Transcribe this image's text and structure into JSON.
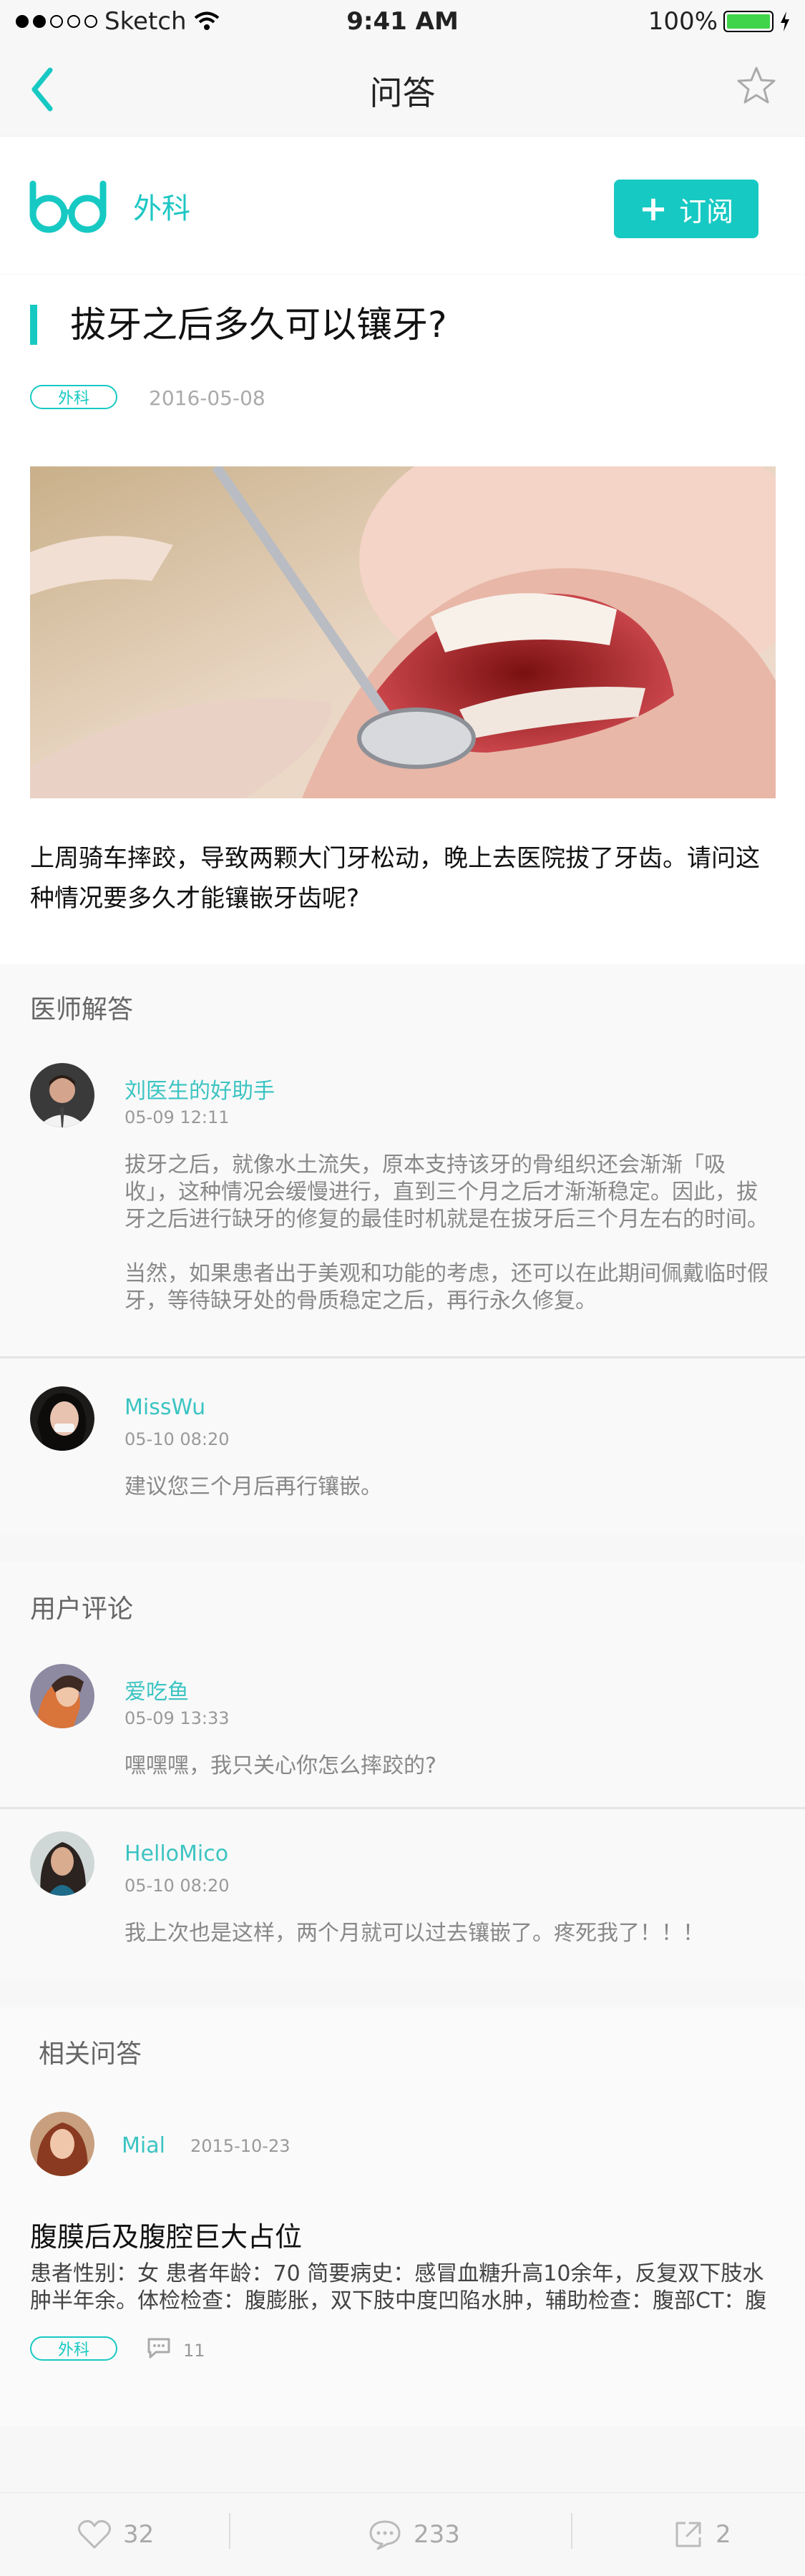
{
  "status_bar": {
    "carrier": "Sketch",
    "time": "9:41 AM",
    "battery": "100%"
  },
  "nav": {
    "title": "问答"
  },
  "category": {
    "name": "外科",
    "subscribe_label": "订阅"
  },
  "article": {
    "title": "拔牙之后多久可以镶牙?",
    "tag": "外科",
    "date": "2016-05-08",
    "body": "上周骑车摔跤，导致两颗大门牙松动，晚上去医院拔了牙齿。请问这种情况要多久才能镶嵌牙齿呢?"
  },
  "doctor_answers": {
    "title": "医师解答",
    "items": [
      {
        "name": "刘医生的好助手",
        "time": "05-09 12:11",
        "paragraphs": [
          "拔牙之后，就像水土流失，原本支持该牙的骨组织还会渐渐「吸收」，这种情况会缓慢进行，直到三个月之后才渐渐稳定。因此，拔牙之后进行缺牙的修复的最佳时机就是在拔牙后三个月左右的时间。",
          "当然，如果患者出于美观和功能的考虑，还可以在此期间佩戴临时假牙，等待缺牙处的骨质稳定之后，再行永久修复。"
        ]
      },
      {
        "name": "MissWu",
        "time": "05-10 08:20",
        "paragraphs": [
          "建议您三个月后再行镶嵌。"
        ]
      }
    ]
  },
  "user_comments": {
    "title": "用户评论",
    "items": [
      {
        "name": "爱吃鱼",
        "time": "05-09 13:33",
        "text": "嘿嘿嘿，我只关心你怎么摔跤的?"
      },
      {
        "name": "HelloMico",
        "time": "05-10 08:20",
        "text": "我上次也是这样，两个月就可以过去镶嵌了。疼死我了！！！"
      }
    ]
  },
  "related": {
    "title": "相关问答",
    "user": "Mial",
    "date": "2015-10-23",
    "question_title": "腹膜后及腹腔巨大占位",
    "question_body": "患者性别：女  患者年龄：70  简要病史：感冒血糖升高10余年，反复双下肢水肿半年余。体检检查：腹膨胀，双下肢中度凹陷水肿，辅助检查：腹部CT：腹",
    "tag": "外科",
    "comment_count": "11"
  },
  "bottom_bar": {
    "likes": "32",
    "comments": "233",
    "shares": "2"
  },
  "colors": {
    "accent": "#17c9c3"
  }
}
